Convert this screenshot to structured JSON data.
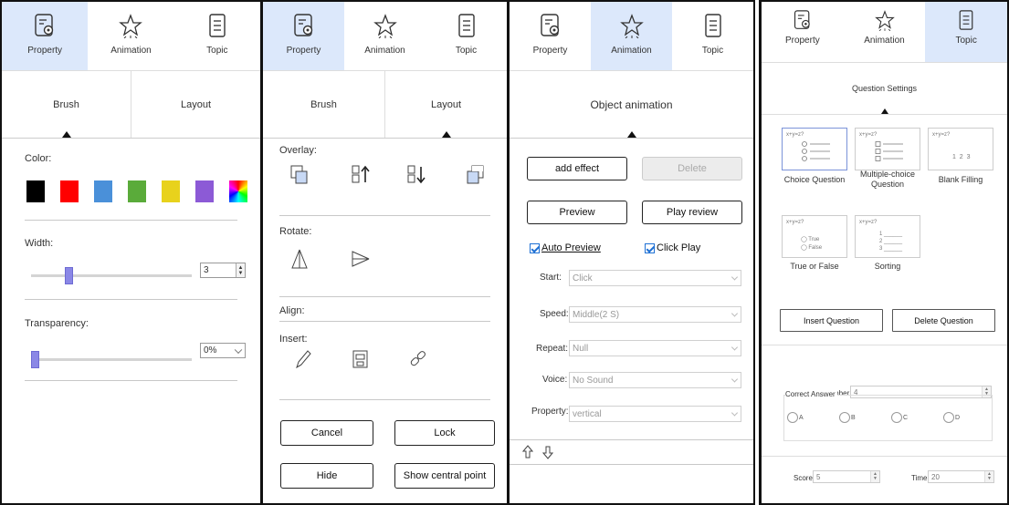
{
  "panel1": {
    "tabs": [
      {
        "label": "Property",
        "icon": "property-icon",
        "active": true
      },
      {
        "label": "Animation",
        "icon": "star-icon",
        "active": false
      },
      {
        "label": "Topic",
        "icon": "document-icon",
        "active": false
      }
    ],
    "subtabs": [
      "Brush",
      "Layout"
    ],
    "color_label": "Color:",
    "colors": [
      "#000000",
      "#ff0000",
      "#4a90d9",
      "#5aab3a",
      "#e8d21c",
      "#8c5ad6",
      "rainbow"
    ],
    "width_label": "Width:",
    "width_value": "3",
    "width_level": 0.22,
    "transparency_label": "Transparency:",
    "transparency_value": "0%",
    "transparency_level": 0.0
  },
  "panel2": {
    "tabs": [
      {
        "label": "Property",
        "icon": "property-icon",
        "active": true
      },
      {
        "label": "Animation",
        "icon": "star-icon",
        "active": false
      },
      {
        "label": "Topic",
        "icon": "document-icon",
        "active": false
      }
    ],
    "subtabs": [
      "Brush",
      "Layout"
    ],
    "overlay_label": "Overlay:",
    "rotate_label": "Rotate:",
    "align_label": "Align:",
    "insert_label": "Insert:",
    "cancel_label": "Cancel",
    "lock_label": "Lock",
    "hide_label": "Hide",
    "central_point_label": "Show central point"
  },
  "panel3": {
    "tabs": [
      {
        "label": "Property",
        "icon": "property-icon",
        "active": false
      },
      {
        "label": "Animation",
        "icon": "star-icon",
        "active": true
      },
      {
        "label": "Topic",
        "icon": "document-icon",
        "active": false
      }
    ],
    "subtab": "Object animation",
    "add_effect_label": "add effect",
    "delete_label": "Delete",
    "preview_label": "Preview",
    "play_review_label": "Play review",
    "auto_preview_label": "Auto Preview",
    "click_play_label": "Click Play",
    "fields": [
      {
        "label": "Start:",
        "value": "Click"
      },
      {
        "label": "Speed:",
        "value": "Middle(2 S)"
      },
      {
        "label": "Repeat:",
        "value": "Null"
      },
      {
        "label": "Voice:",
        "value": "No Sound"
      },
      {
        "label": "Property:",
        "value": "vertical"
      }
    ]
  },
  "panel4": {
    "tabs": [
      {
        "label": "Property",
        "icon": "property-icon",
        "active": false
      },
      {
        "label": "Animation",
        "icon": "star-icon",
        "active": false
      },
      {
        "label": "Topic",
        "icon": "document-icon",
        "active": true
      }
    ],
    "subtab": "Question Settings",
    "q_types": [
      {
        "caption": "Choice Question",
        "tag": "x+y=z?"
      },
      {
        "caption": "Multiple-choice Question",
        "tag": "x+y=z?"
      },
      {
        "caption": "Blank Filling",
        "tag": "x+y=z?",
        "nums": "1  2  3"
      },
      {
        "caption": "True or False",
        "tag": "x+y=z?",
        "opt_true": "True",
        "opt_false": "False"
      },
      {
        "caption": "Sorting",
        "tag": "x+y=z?",
        "n1": "1",
        "n2": "2",
        "n3": "3"
      }
    ],
    "insert_label": "Insert Question",
    "delete_label": "Delete Question",
    "option_number_label": "Option Number:",
    "option_number_value": "4",
    "correct_answer_label": "Correct Answer",
    "answers": [
      "A",
      "B",
      "C",
      "D"
    ],
    "score_label": "Score:",
    "score_value": "5",
    "time_label": "Time:",
    "time_value": "20"
  }
}
